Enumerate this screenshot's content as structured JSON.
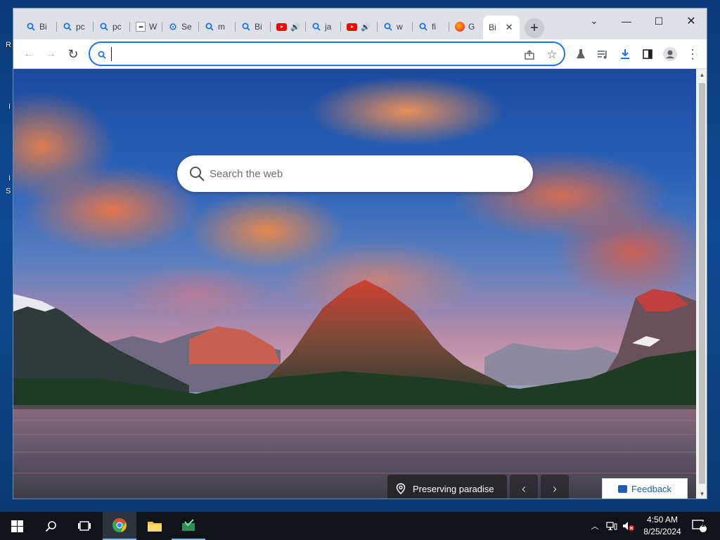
{
  "window": {
    "controls": {
      "minimize": "—",
      "maximize": "☐",
      "close": "✕",
      "tab_search": "⌄"
    }
  },
  "tabs": [
    {
      "label": "Bi",
      "icon": "search-icon"
    },
    {
      "label": "pc",
      "icon": "search-icon"
    },
    {
      "label": "pc",
      "icon": "search-icon"
    },
    {
      "label": "W",
      "icon": "dots-favicon"
    },
    {
      "label": "Se",
      "icon": "gear-icon"
    },
    {
      "label": "m",
      "icon": "search-icon"
    },
    {
      "label": "Bi",
      "icon": "search-icon"
    },
    {
      "label": "",
      "icon": "youtube-icon",
      "audio": true
    },
    {
      "label": "ja",
      "icon": "search-icon"
    },
    {
      "label": "",
      "icon": "youtube-icon",
      "audio": true
    },
    {
      "label": "w",
      "icon": "search-icon"
    },
    {
      "label": "fi",
      "icon": "search-icon"
    },
    {
      "label": "G",
      "icon": "firefox-icon"
    },
    {
      "label": "Bi",
      "icon": "none",
      "active": true,
      "close": "✕"
    }
  ],
  "new_tab_label": "+",
  "toolbar": {
    "address_value": "",
    "back": "←",
    "forward": "→",
    "reload": "↻",
    "extensions": [
      "share-icon",
      "bookmark-star-icon",
      "labs-flask-icon",
      "media-playlist-icon",
      "download-icon",
      "side-panel-icon",
      "profile-icon",
      "menu-dots-icon"
    ]
  },
  "page": {
    "search_placeholder": "Search the web",
    "caption": "Preserving paradise",
    "prev": "‹",
    "next": "›",
    "feedback": "Feedback"
  },
  "desktop": {
    "labels": [
      "R",
      "I",
      "I",
      "S"
    ]
  },
  "taskbar": {
    "time": "4:50 AM",
    "date": "8/25/2024",
    "notification_count": "1",
    "apps": [
      "start-icon",
      "search-icon",
      "task-view-icon",
      "chrome-icon",
      "file-explorer-icon",
      "app-icon"
    ]
  },
  "colors": {
    "accent": "#1a73e8",
    "taskbar": "#101418",
    "tabstrip": "#dee1e6"
  }
}
